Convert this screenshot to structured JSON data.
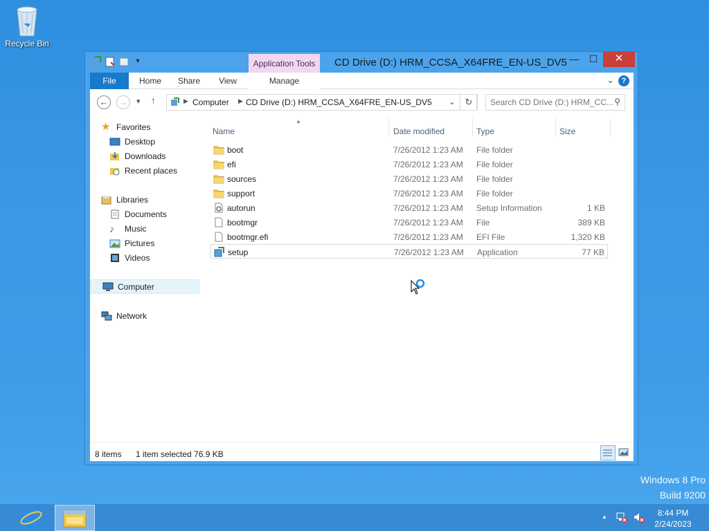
{
  "desktop": {
    "recycle_bin_label": "Recycle Bin",
    "watermark_line1": "Windows 8 Pro",
    "watermark_line2": "Build 9200"
  },
  "window": {
    "title": "CD Drive (D:) HRM_CCSA_X64FRE_EN-US_DV5",
    "contextual_tab": "Application Tools",
    "controls": {
      "minimize": "—",
      "maximize": "☐",
      "close": "✕"
    }
  },
  "ribbon": {
    "tabs": [
      "File",
      "Home",
      "Share",
      "View",
      "Manage"
    ],
    "help": "?"
  },
  "address": {
    "crumbs": [
      "Computer",
      "CD Drive (D:) HRM_CCSA_X64FRE_EN-US_DV5"
    ],
    "search_placeholder": "Search CD Drive (D:) HRM_CC..."
  },
  "nav": {
    "favorites": {
      "label": "Favorites",
      "items": [
        "Desktop",
        "Downloads",
        "Recent places"
      ]
    },
    "libraries": {
      "label": "Libraries",
      "items": [
        "Documents",
        "Music",
        "Pictures",
        "Videos"
      ]
    },
    "computer": "Computer",
    "network": "Network"
  },
  "columns": {
    "name": "Name",
    "date": "Date modified",
    "type": "Type",
    "size": "Size"
  },
  "files": [
    {
      "name": "boot",
      "date": "7/26/2012 1:23 AM",
      "type": "File folder",
      "size": "",
      "icon": "folder-icon"
    },
    {
      "name": "efi",
      "date": "7/26/2012 1:23 AM",
      "type": "File folder",
      "size": "",
      "icon": "folder-icon"
    },
    {
      "name": "sources",
      "date": "7/26/2012 1:23 AM",
      "type": "File folder",
      "size": "",
      "icon": "folder-icon"
    },
    {
      "name": "support",
      "date": "7/26/2012 1:23 AM",
      "type": "File folder",
      "size": "",
      "icon": "folder-icon"
    },
    {
      "name": "autorun",
      "date": "7/26/2012 1:23 AM",
      "type": "Setup Information",
      "size": "1 KB",
      "icon": "settings-file-icon"
    },
    {
      "name": "bootmgr",
      "date": "7/26/2012 1:23 AM",
      "type": "File",
      "size": "389 KB",
      "icon": "file-icon"
    },
    {
      "name": "bootmgr.efi",
      "date": "7/26/2012 1:23 AM",
      "type": "EFI File",
      "size": "1,320 KB",
      "icon": "file-icon"
    },
    {
      "name": "setup",
      "date": "7/26/2012 1:23 AM",
      "type": "Application",
      "size": "77 KB",
      "icon": "setup-app-icon",
      "selected": true
    }
  ],
  "status": {
    "count": "8 items",
    "selection": "1 item selected  76.9 KB"
  },
  "taskbar": {
    "time": "8:44 PM",
    "date": "2/24/2023"
  },
  "colors": {
    "accent": "#1979ca",
    "close": "#c7403a",
    "context_tab": "#f3d6f0",
    "folder": "#f2c84b"
  }
}
